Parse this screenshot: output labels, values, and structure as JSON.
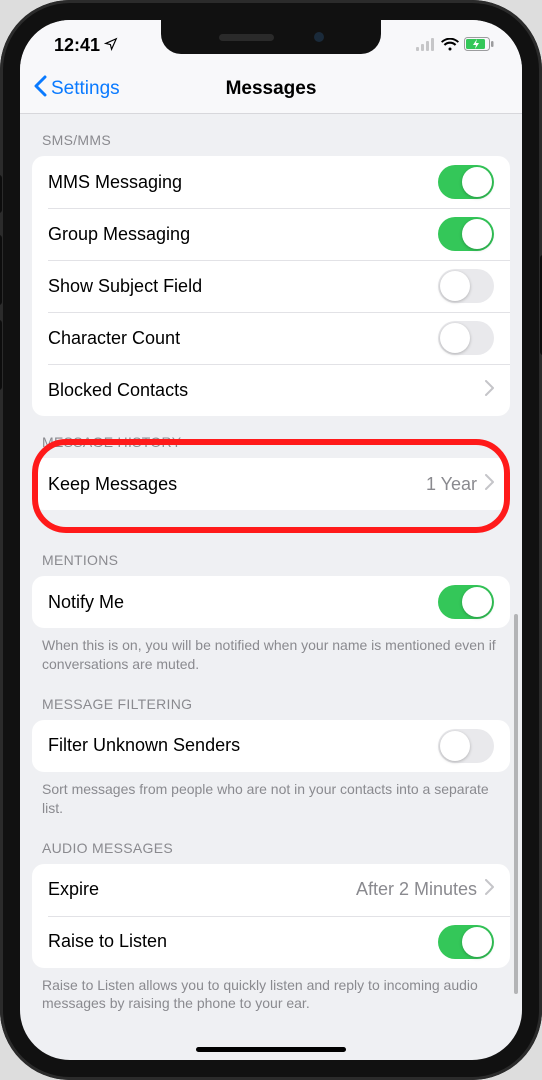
{
  "statusbar": {
    "time": "12:41"
  },
  "nav": {
    "back": "Settings",
    "title": "Messages"
  },
  "sections": {
    "sms": {
      "header": "SMS/MMS",
      "mms": "MMS Messaging",
      "group": "Group Messaging",
      "subject": "Show Subject Field",
      "charcount": "Character Count",
      "blocked": "Blocked Contacts"
    },
    "history": {
      "header": "MESSAGE HISTORY",
      "keep": "Keep Messages",
      "keep_value": "1 Year"
    },
    "mentions": {
      "header": "MENTIONS",
      "notify": "Notify Me",
      "footer": "When this is on, you will be notified when your name is mentioned even if conversations are muted."
    },
    "filtering": {
      "header": "MESSAGE FILTERING",
      "filter": "Filter Unknown Senders",
      "footer": "Sort messages from people who are not in your contacts into a separate list."
    },
    "audio": {
      "header": "AUDIO MESSAGES",
      "expire": "Expire",
      "expire_value": "After 2 Minutes",
      "raise": "Raise to Listen",
      "footer": "Raise to Listen allows you to quickly listen and reply to incoming audio messages by raising the phone to your ear."
    }
  }
}
